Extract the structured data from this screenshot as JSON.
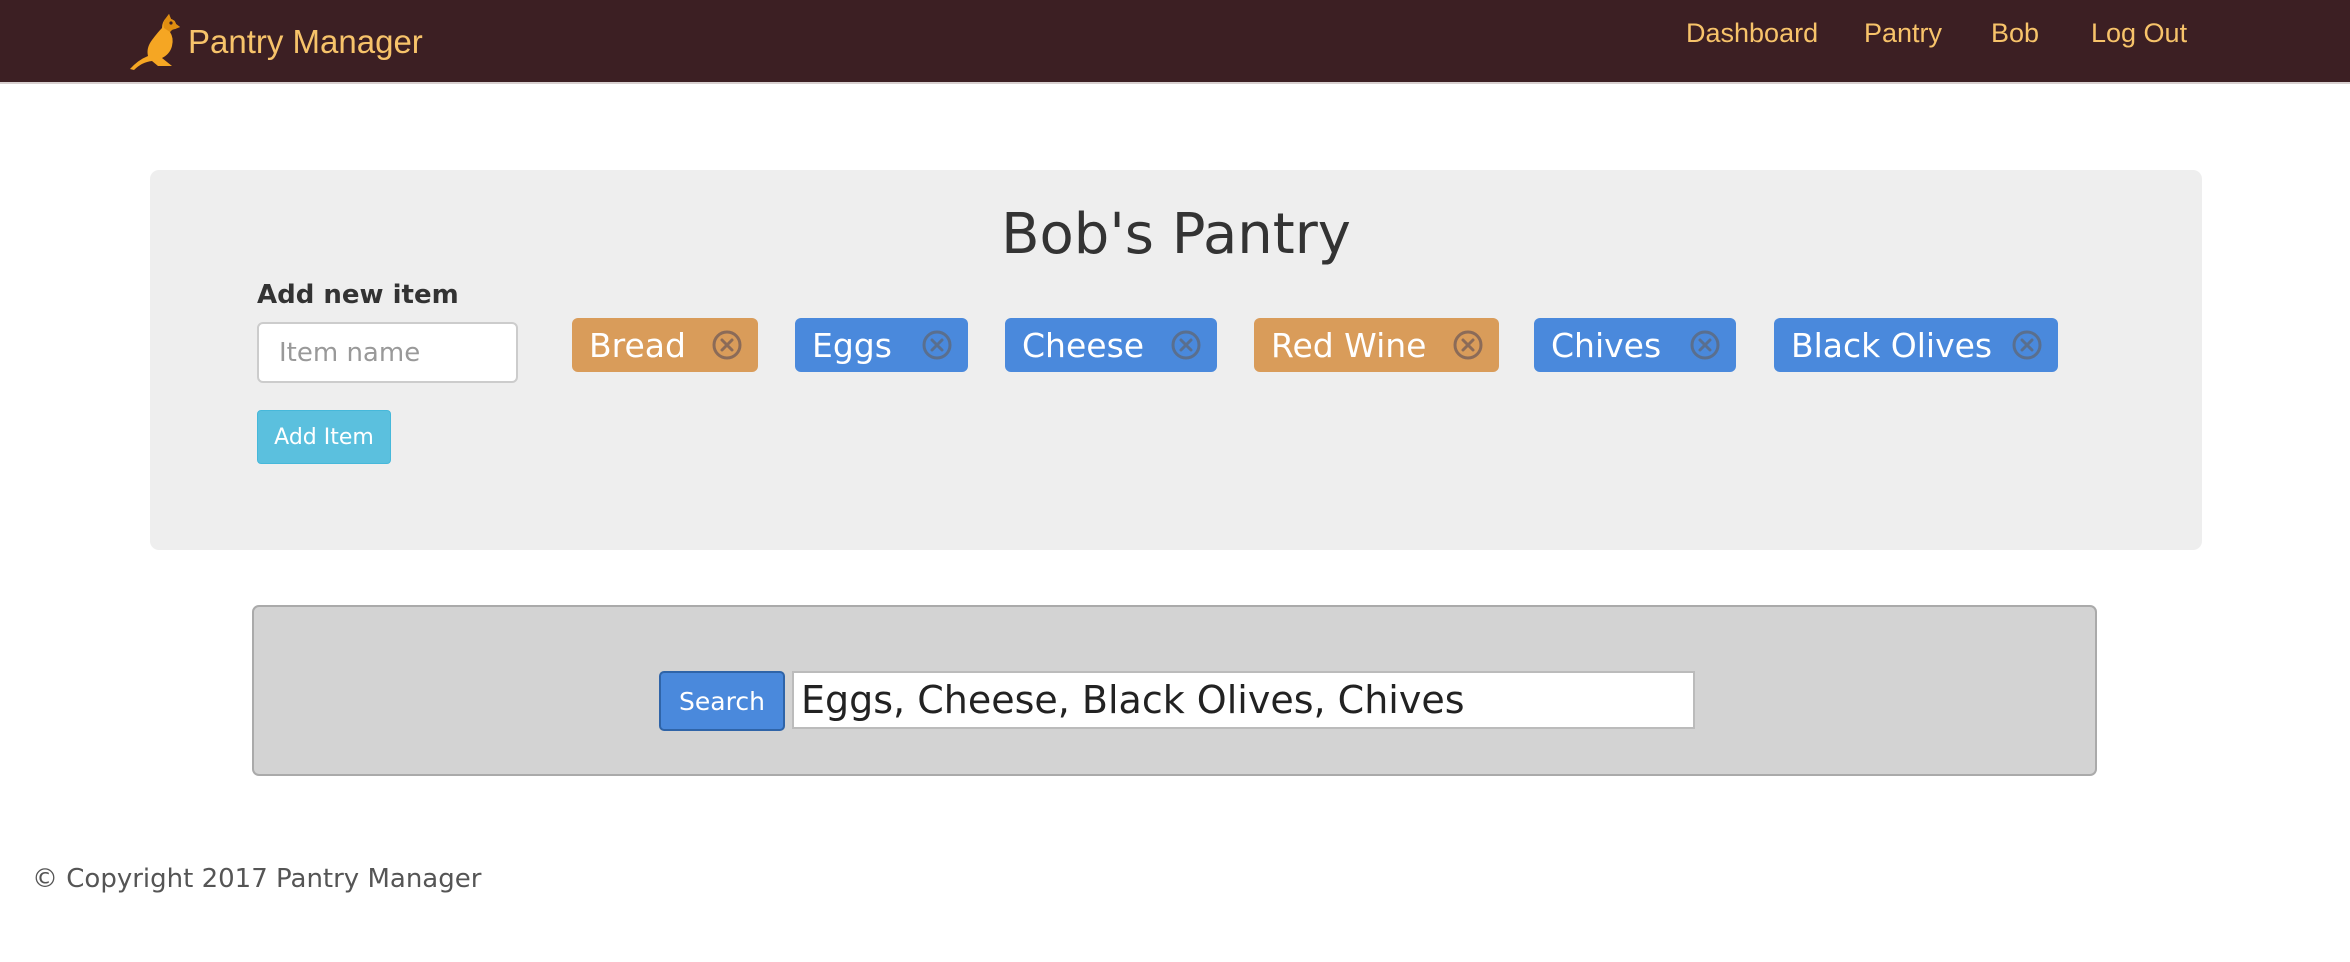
{
  "colors": {
    "navbar_bg": "#3c1f23",
    "nav_text": "#f7c36a",
    "tag_orange": "#d99c5a",
    "tag_blue": "#4a89dc",
    "add_button": "#5bc0de",
    "search_button": "#4a89dc"
  },
  "navbar": {
    "brand": "Pantry Manager",
    "brand_icon": "kangaroo-logo-icon",
    "links": [
      {
        "label": "Dashboard"
      },
      {
        "label": "Pantry"
      },
      {
        "label": "Bob"
      },
      {
        "label": "Log Out"
      }
    ]
  },
  "pantry": {
    "title": "Bob's Pantry",
    "add_label": "Add new item",
    "input_placeholder": "Item name",
    "add_button": "Add Item",
    "items": [
      {
        "label": "Bread",
        "color": "orange",
        "remove_icon": "circle-x-icon"
      },
      {
        "label": "Eggs",
        "color": "blue",
        "remove_icon": "circle-x-icon"
      },
      {
        "label": "Cheese",
        "color": "blue",
        "remove_icon": "circle-x-icon"
      },
      {
        "label": "Red Wine",
        "color": "orange",
        "remove_icon": "circle-x-icon"
      },
      {
        "label": "Chives",
        "color": "blue",
        "remove_icon": "circle-x-icon"
      },
      {
        "label": "Black Olives",
        "color": "blue",
        "remove_icon": "circle-x-icon"
      }
    ]
  },
  "search": {
    "button": "Search",
    "value": "Eggs, Cheese, Black Olives, Chives"
  },
  "footer": {
    "copyright": "© Copyright 2017 Pantry Manager"
  }
}
